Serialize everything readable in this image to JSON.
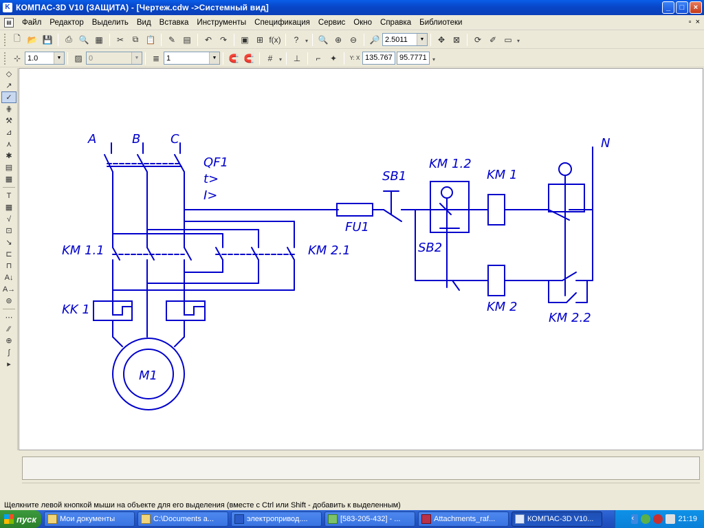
{
  "window": {
    "title": "КОМПАС-3D V10 (ЗАЩИТА) - [Чертеж.cdw ->Системный вид]",
    "app_icon": "K",
    "controls": [
      "minimize-icon",
      "maximize-icon",
      "close-icon"
    ]
  },
  "menu": {
    "items": [
      "Файл",
      "Редактор",
      "Выделить",
      "Вид",
      "Вставка",
      "Инструменты",
      "Спецификация",
      "Сервис",
      "Окно",
      "Справка",
      "Библиотеки"
    ],
    "mdi_restore": "▫",
    "mdi_close": "×"
  },
  "toolbar1": {
    "zoom_value": "2.5011",
    "fx_label": "f(x)",
    "help_label": "?"
  },
  "toolbar2": {
    "step_value": "1.0",
    "layer_value": "0",
    "style_value": "1",
    "coord_label": "Y: X",
    "coord_x": "135.767",
    "coord_y": "95.7771"
  },
  "drawing": {
    "labels": {
      "phase_a": "A",
      "phase_b": "B",
      "phase_c": "C",
      "neutral": "N",
      "breaker": "QF1",
      "breaker_t": "t>",
      "breaker_i": "I>",
      "fuse": "FU1",
      "stop_button": "SB1",
      "start_button": "SB2",
      "km_1_2": "KM 1.2",
      "km_1": "KM 1",
      "km_2": "KM 2",
      "km_2_2": "KM 2.2",
      "km_1_1": "KM 1.1",
      "km_2_1": "KM 2.1",
      "thermal_relay": "KK 1",
      "motor": "M1"
    },
    "line_color": "#0000cc"
  },
  "status": {
    "hint": "Щелкните левой кнопкой мыши на объекте для его выделения (вместе с Ctrl или Shift - добавить к выделенным)"
  },
  "taskbar": {
    "start_label": "пуск",
    "tasks": [
      {
        "label": "Мои документы",
        "active": false
      },
      {
        "label": "C:\\Documents a...",
        "active": false
      },
      {
        "label": "электропривод....",
        "active": false
      },
      {
        "label": "[583-205-432] - ...",
        "active": false
      },
      {
        "label": "Attachments_raf...",
        "active": false
      },
      {
        "label": "КОМПАС-3D V10...",
        "active": true
      }
    ],
    "clock": "21:19"
  }
}
